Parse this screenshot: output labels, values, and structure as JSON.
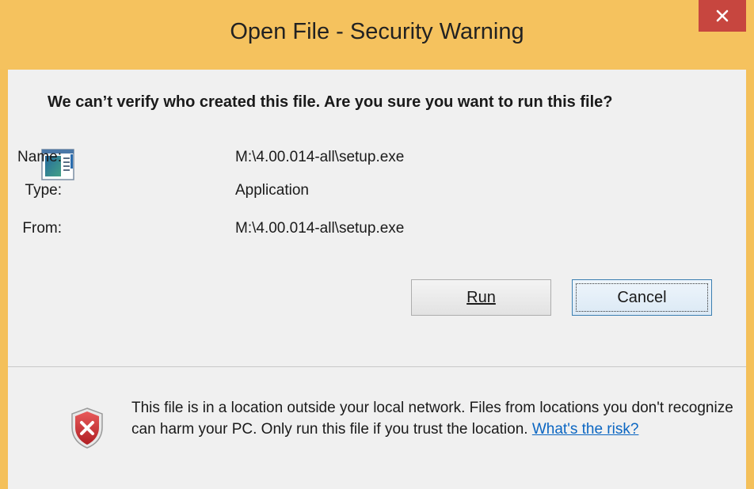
{
  "window": {
    "title": "Open File - Security Warning",
    "close_glyph": "✕"
  },
  "dialog": {
    "heading": "We can’t verify who created this file. Are you sure you want to run this file?",
    "file": {
      "name_label": "Name:",
      "name_value": "M:\\4.00.014-all\\setup.exe",
      "type_label": "Type:",
      "type_value": "Application",
      "from_label": "From:",
      "from_value": "M:\\4.00.014-all\\setup.exe"
    },
    "buttons": {
      "run": "Run",
      "cancel": "Cancel"
    }
  },
  "footer": {
    "warning_text": "This file is in a location outside your local network. Files from locations you don't recognize can harm your PC. Only run this file if you trust the location.",
    "risk_link": "What's the risk?"
  },
  "icons": {
    "app": "application-icon",
    "shield": "security-shield-icon",
    "close": "close-icon"
  },
  "colors": {
    "titlebar": "#f5c25e",
    "close_button": "#c7463f",
    "client_bg": "#f0f0f0",
    "link": "#0b66c2"
  }
}
